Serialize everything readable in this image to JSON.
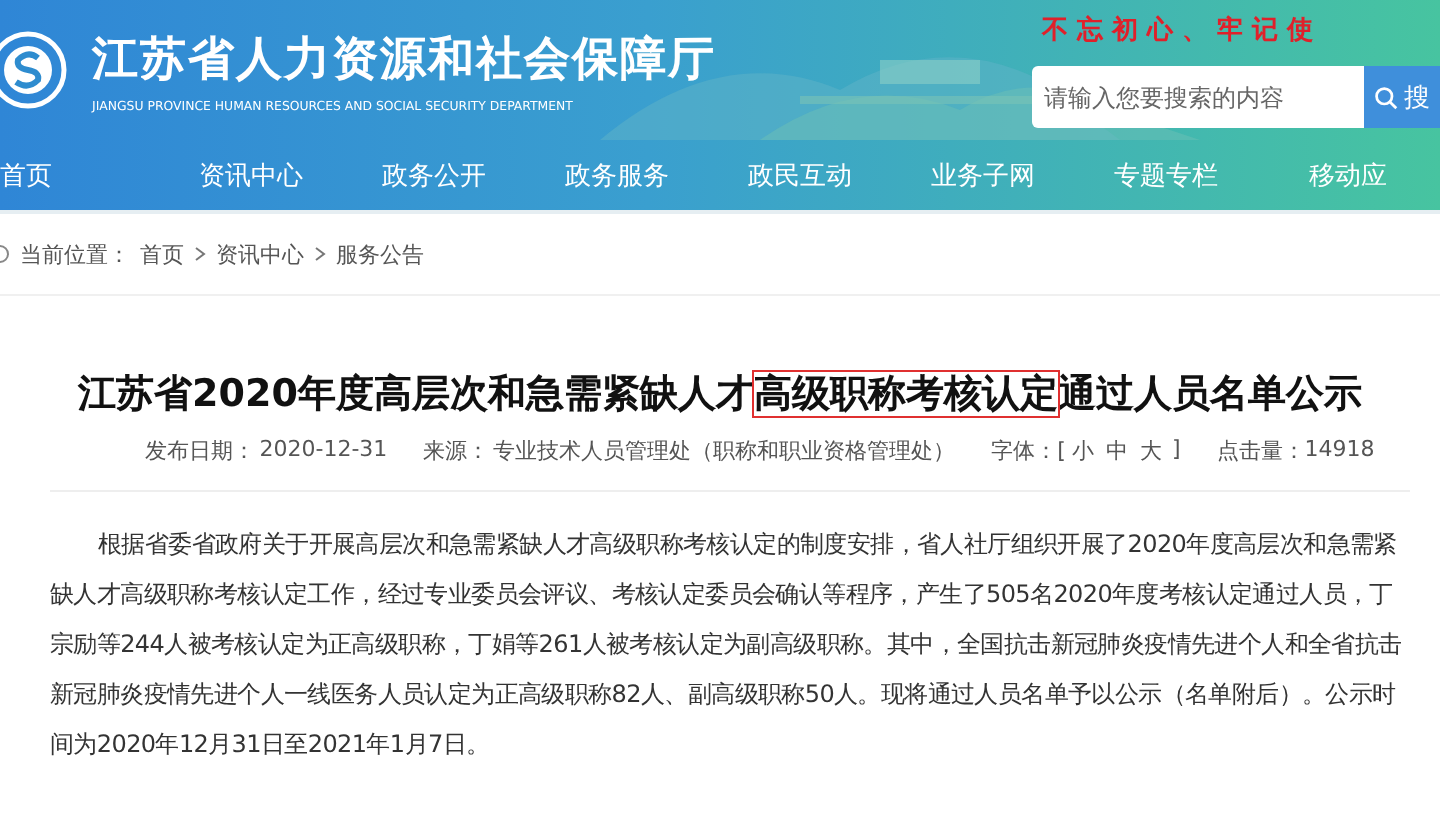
{
  "header": {
    "title": "江苏省人力资源和社会保障厅",
    "subtitle": "JIANGSU PROVINCE HUMAN RESOURCES AND SOCIAL SECURITY DEPARTMENT",
    "slogan": "不 忘 初 心 、 牢 记 使",
    "search": {
      "placeholder": "请输入您要搜索的内容",
      "button": "搜"
    }
  },
  "nav": [
    {
      "label": "首页"
    },
    {
      "label": "资讯中心"
    },
    {
      "label": "政务公开"
    },
    {
      "label": "政务服务"
    },
    {
      "label": "政民互动"
    },
    {
      "label": "业务子网"
    },
    {
      "label": "专题专栏"
    },
    {
      "label": "移动应"
    }
  ],
  "breadcrumb": {
    "label": "当前位置：",
    "items": [
      "首页",
      "资讯中心",
      "服务公告"
    ]
  },
  "article": {
    "title": {
      "before": "江苏省2020年度高层次和急需紧缺人才",
      "highlighted": "高级职称考核认定",
      "after": "通过人员名单公示"
    },
    "meta": {
      "date_label": "发布日期：",
      "date": "2020-12-31",
      "source_label": "来源：",
      "source": "专业技术人员管理处（职称和职业资格管理处）",
      "font_label": "字体：[",
      "font_sizes": [
        "小",
        "中",
        "大"
      ],
      "font_end": "]",
      "hits_label": "点击量：",
      "hits": "14918"
    },
    "body": "根据省委省政府关于开展高层次和急需紧缺人才高级职称考核认定的制度安排，省人社厅组织开展了2020年度高层次和急需紧缺人才高级职称考核认定工作，经过专业委员会评议、考核认定委员会确认等程序，产生了505名2020年度考核认定通过人员，丁宗励等244人被考核认定为正高级职称，丁娟等261人被考核认定为副高级职称。其中，全国抗击新冠肺炎疫情先进个人和全省抗击新冠肺炎疫情先进个人一线医务人员认定为正高级职称82人、副高级职称50人。现将通过人员名单予以公示（名单附后）。公示时间为2020年12月31日至2021年1月7日。"
  }
}
